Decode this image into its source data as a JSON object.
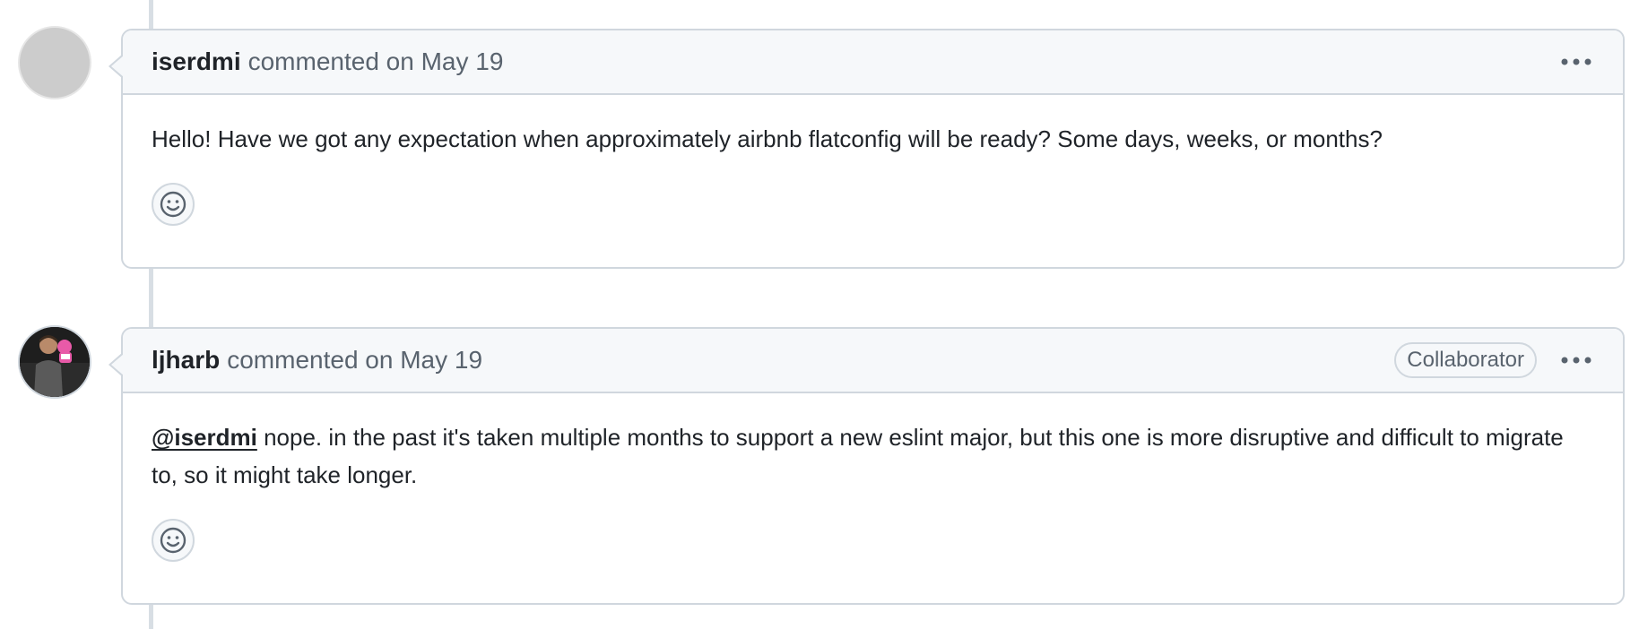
{
  "comments": [
    {
      "author": "iserdmi",
      "meta": "commented on May 19",
      "body": "Hello! Have we got any expectation when approximately airbnb flatconfig will be ready? Some days, weeks, or months?"
    },
    {
      "author": "ljharb",
      "meta": "commented on May 19",
      "badge": "Collaborator",
      "mention": "@iserdmi",
      "body": " nope. in the past it's taken multiple months to support a new eslint major, but this one is more disruptive and difficult to migrate to, so it might take longer."
    }
  ],
  "icons": {
    "menu": "kebab-horizontal-icon",
    "reaction": "smiley-icon"
  },
  "colors": {
    "header_bg": "#f6f8fa",
    "border": "#d0d7de",
    "muted_text": "#59636e",
    "avatar_placeholder": "#cccccc",
    "avatar_accent": "#e85aa8"
  }
}
